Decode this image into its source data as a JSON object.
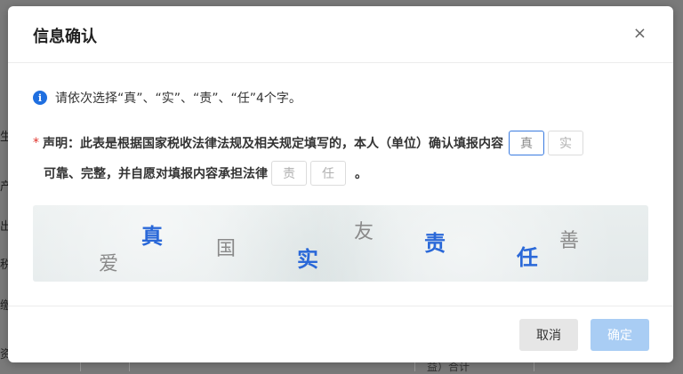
{
  "background": {
    "left_fragments": [
      "生",
      "产",
      "出",
      "税",
      "缴",
      "资"
    ],
    "bottom_fragment": "益）合计"
  },
  "dialog": {
    "title": "信息确认",
    "close_symbol": "×",
    "info": {
      "icon": "info-icon",
      "text": "请依次选择“真”、“实”、“责”、“任”4个字。"
    },
    "declaration": {
      "required_mark": "*",
      "line1": "声明：此表是根据国家税收法律法规及相关规定填写的，本人（单位）确认填报内容",
      "line2": "可靠、完整，并自愿对填报内容承担法律",
      "end_punct": "。",
      "boxes": [
        "真",
        "实",
        "责",
        "任"
      ]
    },
    "captcha": {
      "chars": [
        {
          "text": "爱",
          "highlight": false
        },
        {
          "text": "真",
          "highlight": true
        },
        {
          "text": "国",
          "highlight": false
        },
        {
          "text": "实",
          "highlight": true
        },
        {
          "text": "友",
          "highlight": false
        },
        {
          "text": "责",
          "highlight": true
        },
        {
          "text": "任",
          "highlight": true
        },
        {
          "text": "善",
          "highlight": false
        }
      ]
    },
    "buttons": {
      "cancel": "取消",
      "confirm": "确定"
    }
  },
  "colors": {
    "primary": "#1f6fe0",
    "captcha_blue": "#2a68d8",
    "required": "#e0332c",
    "confirm_disabled": "#a9cdf4"
  }
}
